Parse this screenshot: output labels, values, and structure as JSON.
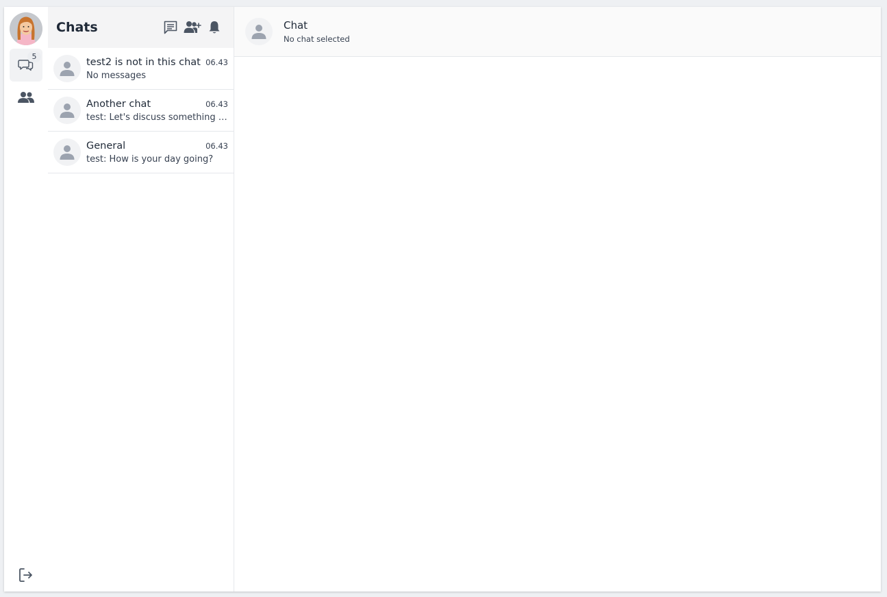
{
  "rail": {
    "avatar_icon": "user-avatar-woman",
    "chats_icon": "chat-bubbles-icon",
    "chats_badge": "5",
    "contacts_icon": "users-icon",
    "logout_icon": "logout-icon"
  },
  "list": {
    "title": "Chats",
    "header_icons": [
      "new-message-icon",
      "add-contact-icon",
      "bell-icon"
    ],
    "chats": [
      {
        "name": "test2 is not in this chat",
        "time": "06.43",
        "preview": "No messages"
      },
      {
        "name": "Another chat",
        "time": "06.43",
        "preview": "test: Let's discuss something in this chat"
      },
      {
        "name": "General",
        "time": "06.43",
        "preview": "test: How is your day going?"
      }
    ]
  },
  "main": {
    "title": "Chat",
    "subtitle": "No chat selected"
  },
  "colors": {
    "icon": "#4b5563",
    "avatar_placeholder": "#9ca3af",
    "header_bg": "#f4f4f5"
  }
}
